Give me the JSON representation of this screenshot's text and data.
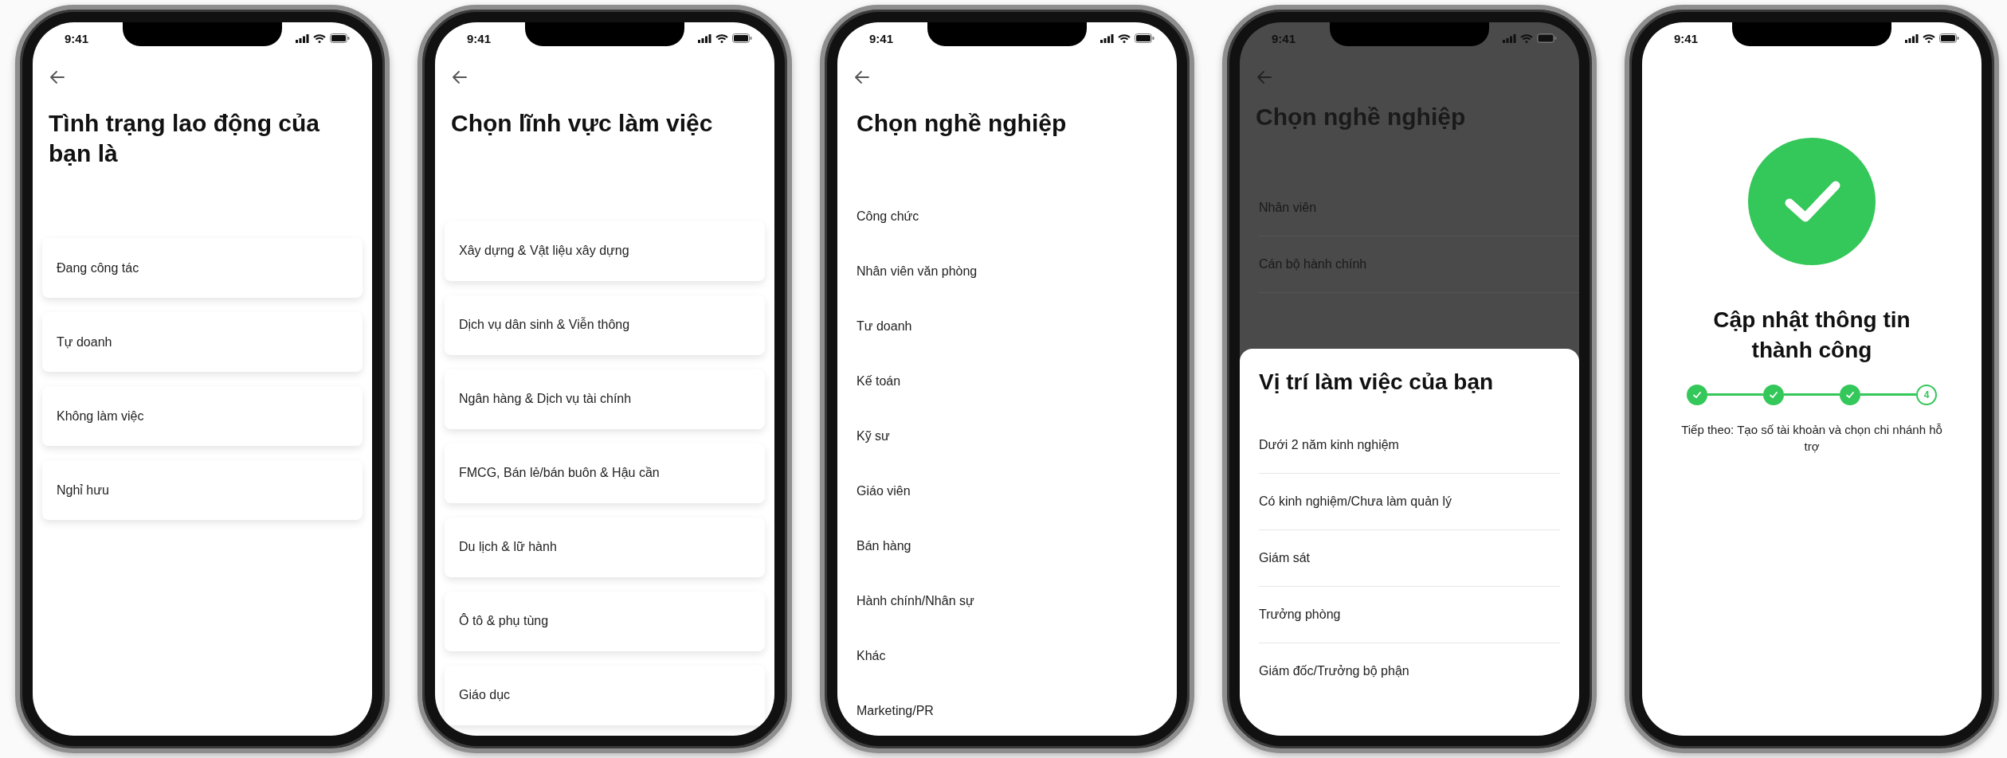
{
  "phones": [
    {
      "kind": "cards",
      "time": "9:41",
      "title": "Tình trạng lao động của bạn là",
      "options": [
        "Đang công tác",
        "Tự doanh",
        "Không làm việc",
        "Nghỉ hưu"
      ]
    },
    {
      "kind": "cards",
      "time": "9:41",
      "title": "Chọn lĩnh vực làm việc",
      "options": [
        "Xây dựng & Vật liệu xây dựng",
        "Dịch vụ dân sinh & Viễn thông",
        "Ngân hàng & Dịch vụ tài chính",
        "FMCG, Bán lẻ/bán buôn & Hậu cần",
        "Du lịch & lữ hành",
        "Ô tô & phụ tùng",
        "Giáo dục"
      ]
    },
    {
      "kind": "list",
      "time": "9:41",
      "title": "Chọn nghề nghiệp",
      "options": [
        "Công chức",
        "Nhân viên văn phòng",
        "Tư doanh",
        "Kế toán",
        "Kỹ sư",
        "Giáo viên",
        "Bán hàng",
        "Hành chính/Nhân sự",
        "Khác",
        "Marketing/PR"
      ]
    },
    {
      "kind": "sheet",
      "time": "9:41",
      "title": "Chọn nghề nghiệp",
      "options": [
        "Nhân viên",
        "Cán bộ hành chính"
      ],
      "sheet": {
        "title": "Vị trí làm việc của bạn",
        "options": [
          "Dưới 2 năm kinh nghiệm",
          "Có kinh nghiệm/Chưa làm quản lý",
          "Giám sát",
          "Trưởng phòng",
          "Giám đốc/Trưởng bộ phận"
        ]
      }
    },
    {
      "kind": "success",
      "time": "9:41",
      "title": "Cập nhật thông tin thành công",
      "steps": [
        {
          "done": true
        },
        {
          "done": true
        },
        {
          "done": true
        },
        {
          "done": false,
          "label": "4"
        }
      ],
      "note": "Tiếp theo: Tạo số tài khoản và chọn chi nhánh hỗ trợ"
    }
  ]
}
